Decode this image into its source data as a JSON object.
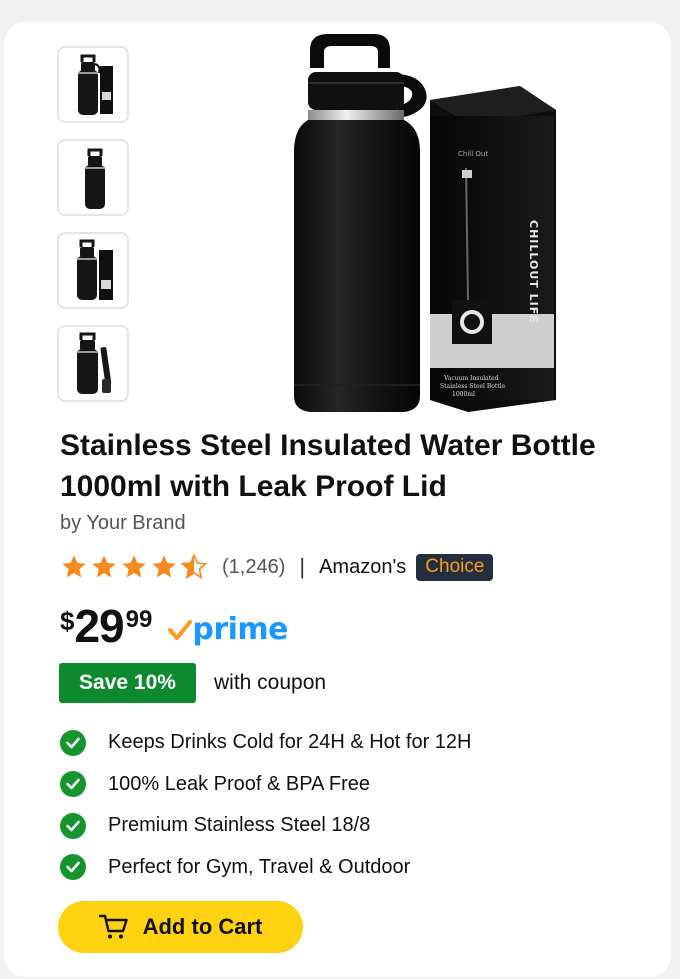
{
  "product": {
    "title_line1": "Stainless Steel Insulated Water Bottle",
    "title_line2": "1000ml with Leak Proof Lid",
    "brand": "by Your Brand",
    "rating": 4.5,
    "rating_count": "(1,246)",
    "separator": "|",
    "badge_prefix": "Amazon's",
    "badge_label": "Choice",
    "box_brand": "CHILLOUT LIFE",
    "box_caption_1": "Vacuum Insulated",
    "box_caption_2": "Stainless Steel Bottle",
    "box_caption_3": "1000ml"
  },
  "price": {
    "currency": "$",
    "whole": "29",
    "fraction": "99",
    "prime_label": "prime"
  },
  "coupon": {
    "badge": "Save 10%",
    "text": "with coupon"
  },
  "features": [
    "Keeps Drinks Cold for 24H & Hot for 12H",
    "100% Leak Proof & BPA Free",
    "Premium Stainless Steel 18/8",
    "Perfect for Gym, Travel & Outdoor"
  ],
  "cart": {
    "label": "Add to Cart"
  },
  "colors": {
    "star": "#f58a1f",
    "prime": "#1a98ff",
    "prime_check": "#ff9a1a",
    "save_badge": "#0d8a2e",
    "check_icon": "#15962d",
    "cart_button": "#ffd20f",
    "choice_bg": "#232f3e",
    "choice_text": "#ff9a1a"
  }
}
